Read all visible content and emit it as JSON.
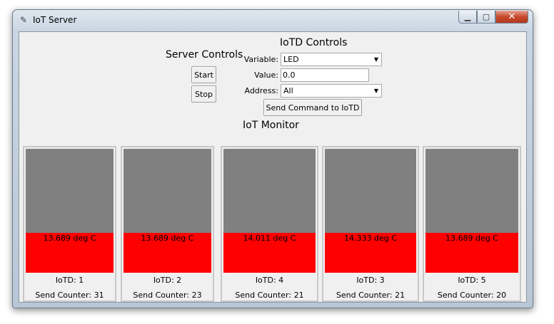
{
  "window": {
    "title": "IoT Server",
    "app_icon": "feather-icon"
  },
  "server_controls": {
    "heading": "Server Controls",
    "start_label": "Start",
    "stop_label": "Stop"
  },
  "iotd_controls": {
    "heading": "IoTD Controls",
    "variable_label": "Variable:",
    "variable_value": "LED",
    "value_label": "Value:",
    "value_value": "0.0",
    "address_label": "Address:",
    "address_value": "All",
    "send_label": "Send Command to IoTD"
  },
  "monitor": {
    "heading": "IoT Monitor",
    "items": [
      {
        "temp": "13.689 deg C",
        "id": "IoTD: 1",
        "counter": "Send Counter: 31",
        "fill": 0.32
      },
      {
        "temp": "13.689 deg C",
        "id": "IoTD: 2",
        "counter": "Send Counter: 23",
        "fill": 0.32
      },
      {
        "temp": "14.011 deg C",
        "id": "IoTD: 4",
        "counter": "Send Counter: 21",
        "fill": 0.32
      },
      {
        "temp": "14.333 deg C",
        "id": "IoTD: 3",
        "counter": "Send Counter: 21",
        "fill": 0.32
      },
      {
        "temp": "13.689 deg C",
        "id": "IoTD: 5",
        "counter": "Send Counter: 20",
        "fill": 0.32
      }
    ]
  },
  "colors": {
    "bar_bg": "#808080",
    "bar_fill": "#ff0000",
    "client_bg": "#f0f0f0"
  }
}
